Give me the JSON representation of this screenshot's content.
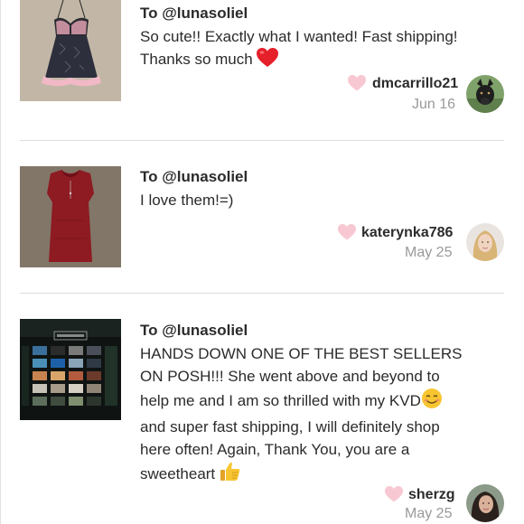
{
  "colors": {
    "heart_pink": "#f8c8d2",
    "heart_red": "#e5202b",
    "divider": "#dcdcdc",
    "date_gray": "#9a9a9a"
  },
  "reviews": [
    {
      "to": "To @lunasoliel",
      "text_lines": [
        "So cute!! Exactly what I wanted! Fast shipping!",
        "Thanks so much"
      ],
      "trailing_icon": "red-heart-emoji",
      "username": "dmcarrillo21",
      "date": "Jun 16",
      "thumbnail": "lace-babydoll-photo",
      "avatar": "dog-avatar"
    },
    {
      "to": "To @lunasoliel",
      "text_lines": [
        "I love them!=)"
      ],
      "username": "katerynka786",
      "date": "May 25",
      "thumbnail": "red-top-photo",
      "avatar": "blonde-woman-avatar"
    },
    {
      "to": "To @lunasoliel",
      "text_lines": [
        "HANDS DOWN ONE OF THE BEST SELLERS",
        "ON POSH!!! She went above and beyond to",
        "help me and I am so thrilled with my KVD",
        "and super fast shipping, I will definitely shop",
        "here often! Again, Thank You, you are a",
        "sweetheart"
      ],
      "inline_icons": [
        "smiling-face-emoji",
        "thumbs-up-emoji"
      ],
      "username": "sherzg",
      "date": "May 25",
      "thumbnail": "eyeshadow-palette-photo",
      "avatar": "woman-avatar"
    }
  ]
}
